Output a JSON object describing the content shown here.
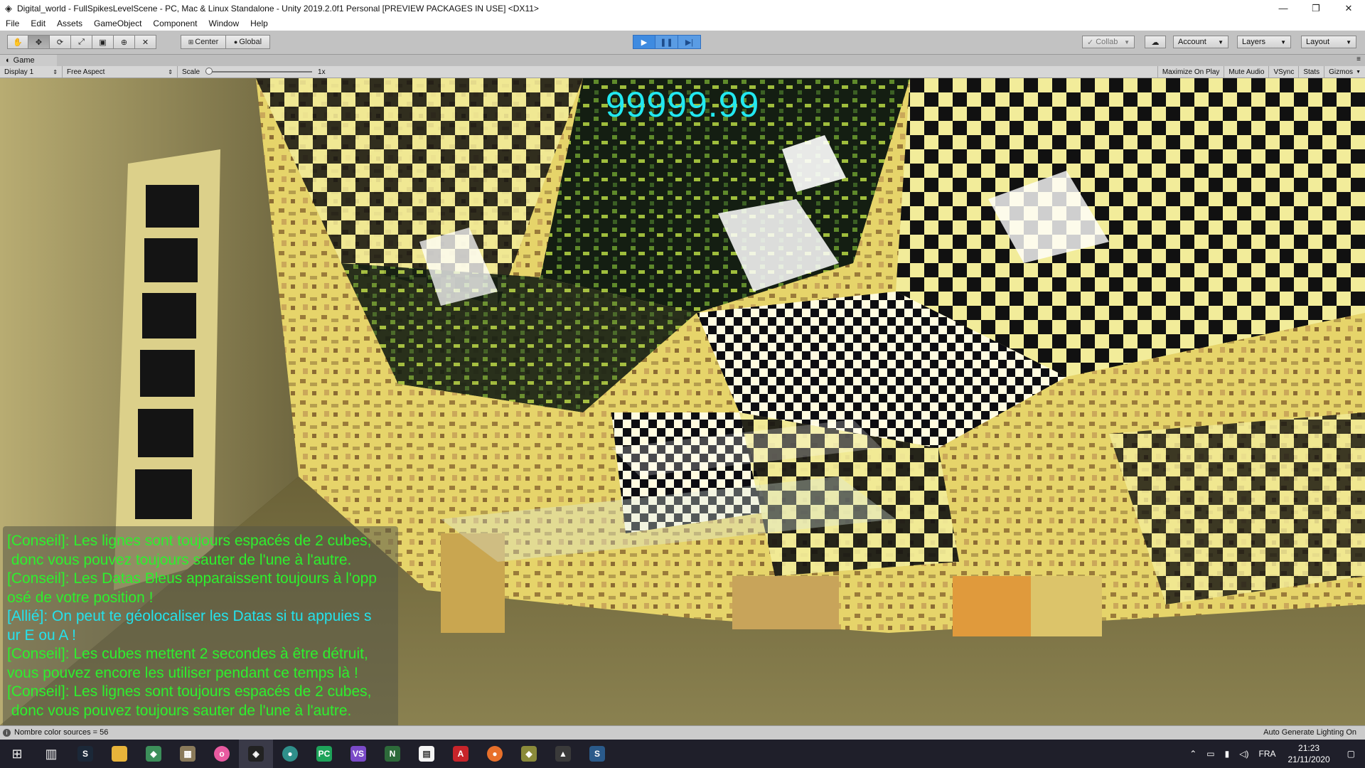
{
  "window": {
    "title": "Digital_world - FullSpikesLevelScene - PC, Mac & Linux Standalone - Unity 2019.2.0f1 Personal [PREVIEW PACKAGES IN USE] <DX11>",
    "minimize": "—",
    "maximize": "❐",
    "close": "✕"
  },
  "menu": [
    "File",
    "Edit",
    "Assets",
    "GameObject",
    "Component",
    "Window",
    "Help"
  ],
  "toolbar": {
    "pivot_label": "Center",
    "space_label": "Global",
    "collab_label": "Collab",
    "account_label": "Account",
    "layers_label": "Layers",
    "layout_label": "Layout"
  },
  "game_tab": {
    "tab_label": "Game",
    "display_label": "Display 1",
    "aspect_label": "Free Aspect",
    "scale_label": "Scale",
    "scale_value": "1x",
    "scale_level": 0.0,
    "buttons": [
      "Maximize On Play",
      "Mute Audio",
      "VSync",
      "Stats",
      "Gizmos"
    ]
  },
  "hud": {
    "timer": "99999.99"
  },
  "chat": [
    {
      "kind": "green",
      "text": "[Conseil]: Les lignes sont toujours espacés de 2 cubes,\n donc vous pouvez toujours sauter de l'une à l'autre."
    },
    {
      "kind": "green",
      "text": "[Conseil]: Les Datas Bleus apparaissent toujours à l'opp\nosé de votre position !"
    },
    {
      "kind": "cyan",
      "text": "[Allié]: On peut te géolocaliser les Datas si tu appuies s\nur E ou A !"
    },
    {
      "kind": "green",
      "text": "[Conseil]: Les cubes mettent 2 secondes à être détruit,\nvous pouvez encore les utiliser pendant ce temps là !"
    },
    {
      "kind": "green",
      "text": "[Conseil]: Les lignes sont toujours espacés de 2 cubes,\n donc vous pouvez toujours sauter de l'une à l'autre."
    }
  ],
  "status": {
    "left": "Nombre color sources = 56",
    "right": "Auto Generate Lighting On"
  },
  "taskbar": {
    "language": "FRA",
    "time": "21:23",
    "date": "21/11/2020"
  },
  "colors": {
    "timer": "#22e8f0",
    "tip_green": "#2df02d",
    "ally_cyan": "#24e2ec",
    "play_active": "#3f8be0"
  }
}
